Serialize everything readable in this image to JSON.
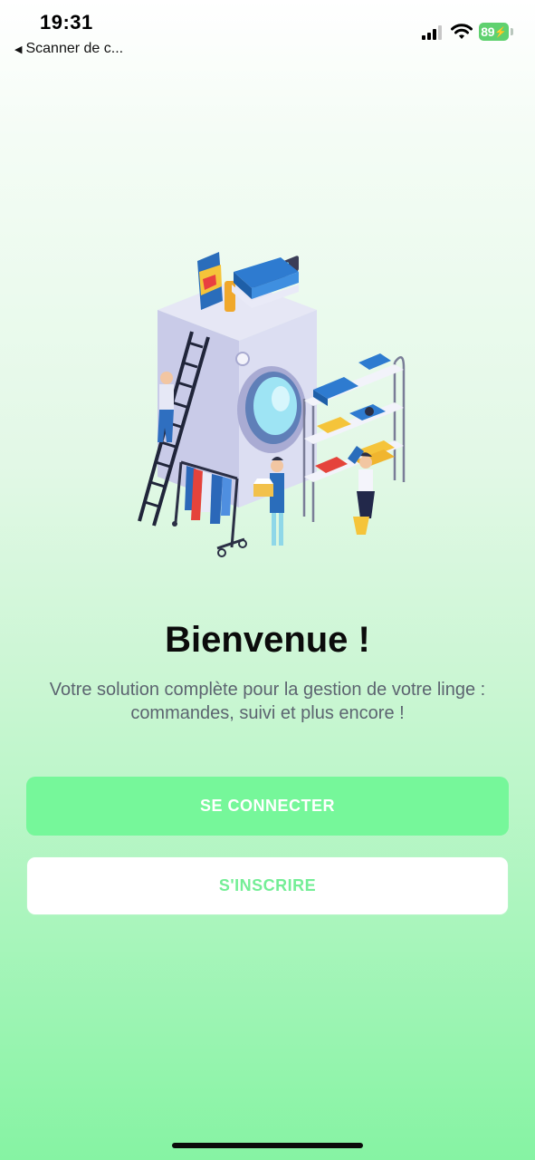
{
  "status_bar": {
    "time": "19:31",
    "back_label": "Scanner de c...",
    "battery": "89"
  },
  "welcome": {
    "title": "Bienvenue !",
    "subtitle": "Votre solution complète pour la gestion de votre linge : commandes, suivi et plus encore !"
  },
  "actions": {
    "login_label": "SE CONNECTER",
    "signup_label": "S'INSCRIRE"
  },
  "colors": {
    "primary": "#76f79a",
    "signup_text": "#74ee96",
    "title": "#0b0b0b",
    "subtitle": "#5c6470"
  },
  "icons": [
    "back-arrow-icon",
    "signal-icon",
    "wifi-icon",
    "battery-icon",
    "laundry-illustration"
  ]
}
